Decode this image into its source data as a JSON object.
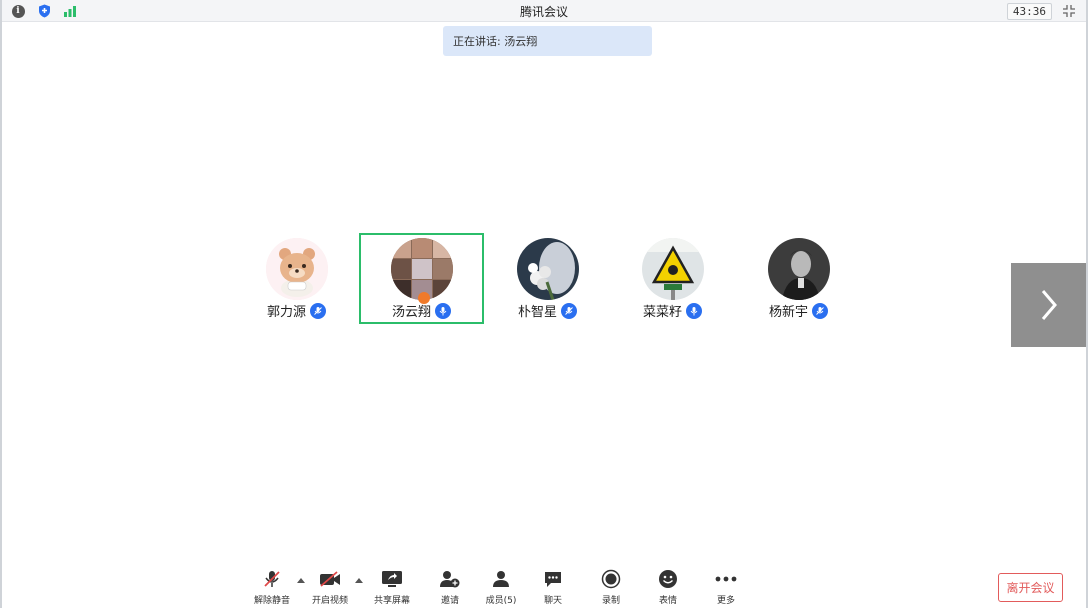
{
  "window": {
    "title": "腾讯会议",
    "timer": "43:36"
  },
  "banner": {
    "speaking_label": "正在讲话: 汤云翔"
  },
  "participants": [
    {
      "name": "郭力源",
      "mic": "muted",
      "active": false,
      "avatar": "bear-avatar"
    },
    {
      "name": "汤云翔",
      "mic": "on",
      "active": true,
      "host": true,
      "avatar": "photo-avatar"
    },
    {
      "name": "朴智星",
      "mic": "muted",
      "active": false,
      "avatar": "flowers-avatar"
    },
    {
      "name": "菜菜籽",
      "mic": "on",
      "active": false,
      "avatar": "warning-sign-avatar"
    },
    {
      "name": "杨新宇",
      "mic": "muted",
      "active": false,
      "avatar": "portrait-avatar"
    }
  ],
  "toolbar": {
    "unmute": "解除静音",
    "video": "开启视频",
    "share": "共享屏幕",
    "invite": "邀请",
    "members": "成员(5)",
    "chat": "聊天",
    "record": "录制",
    "reaction": "表情",
    "more": "更多",
    "leave": "离开会议"
  },
  "colors": {
    "accent": "#2a6ff0",
    "active_border": "#2bbd6a",
    "leave": "#e25b5b",
    "banner_bg": "#dbe7f9"
  }
}
